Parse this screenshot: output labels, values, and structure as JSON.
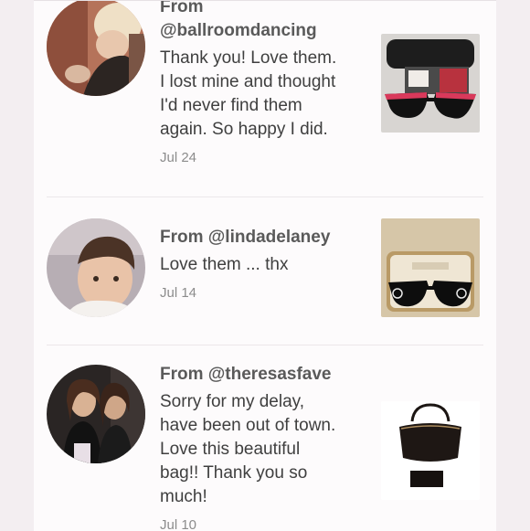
{
  "reviews": [
    {
      "from": "From @ballroomdancing",
      "from_lines": [
        "From",
        "@ballroomdancing"
      ],
      "text_lines": [
        "Thank you! Love them.",
        "I lost mine and thought",
        "I'd never find them",
        "again. So happy I did."
      ],
      "date": "Jul 24"
    },
    {
      "from": "From @lindadelaney",
      "text_lines": [
        "Love them ... thx"
      ],
      "date": "Jul 14"
    },
    {
      "from": "From @theresasfave",
      "text_lines": [
        "Sorry for my delay,",
        "have been out of town.",
        "Love this beautiful",
        "bag!! Thank you so",
        "much!"
      ],
      "date": "Jul 10"
    }
  ],
  "colors": {
    "page_bg": "#f3eef1",
    "card_bg": "#fdfbfc",
    "name_text": "#5a5a5a",
    "body_text": "#3f3f3f",
    "date_text": "#8c8c8c"
  }
}
